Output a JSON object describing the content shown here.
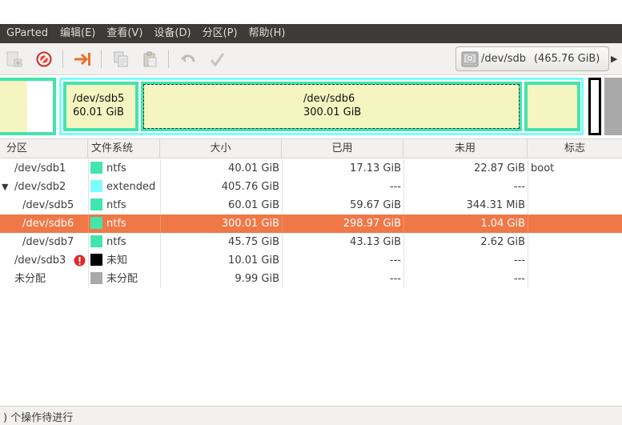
{
  "menubar": {
    "app_name": "GParted",
    "items": [
      "编辑(E)",
      "查看(V)",
      "设备(D)",
      "分区(P)",
      "帮助(H)"
    ]
  },
  "toolbar": {
    "buttons": [
      "new-partition-icon",
      "delete-icon",
      "resize-move-icon",
      "copy-icon",
      "paste-icon",
      "undo-icon",
      "apply-icon"
    ]
  },
  "device": {
    "name": "/dev/sdb",
    "size": "(465.76 GiB)"
  },
  "diskmap": {
    "partitions": [
      {
        "name": "/dev/sdb5",
        "size": "60.01 GiB"
      },
      {
        "name": "/dev/sdb6",
        "size": "300.01 GiB"
      }
    ]
  },
  "table": {
    "columns": [
      "分区",
      "文件系统",
      "大小",
      "已用",
      "未用",
      "标志"
    ],
    "rows": [
      {
        "partition": "/dev/sdb1",
        "fs": "ntfs",
        "fs_color": "#42e5ac",
        "size": "40.01 GiB",
        "used": "17.13 GiB",
        "unused": "22.87 GiB",
        "flags": "boot"
      },
      {
        "partition": "/dev/sdb2",
        "fs": "extended",
        "fs_color": "#7dfcfe",
        "size": "405.76 GiB",
        "used": "---",
        "unused": "---",
        "flags": ""
      },
      {
        "partition": "/dev/sdb5",
        "fs": "ntfs",
        "fs_color": "#42e5ac",
        "size": "60.01 GiB",
        "used": "59.67 GiB",
        "unused": "344.31 MiB",
        "flags": ""
      },
      {
        "partition": "/dev/sdb6",
        "fs": "ntfs",
        "fs_color": "#42e5ac",
        "size": "300.01 GiB",
        "used": "298.97 GiB",
        "unused": "1.04 GiB",
        "flags": ""
      },
      {
        "partition": "/dev/sdb7",
        "fs": "ntfs",
        "fs_color": "#42e5ac",
        "size": "45.75 GiB",
        "used": "43.13 GiB",
        "unused": "2.62 GiB",
        "flags": ""
      },
      {
        "partition": "/dev/sdb3",
        "fs": "未知",
        "fs_color": "#000000",
        "size": "10.01 GiB",
        "used": "---",
        "unused": "---",
        "flags": ""
      },
      {
        "partition": "未分配",
        "fs": "未分配",
        "fs_color": "#a9a9a9",
        "size": "9.99 GiB",
        "used": "---",
        "unused": "---",
        "flags": ""
      }
    ]
  },
  "status": {
    "text": ") 个操作待进行"
  },
  "colors": {
    "menubar_bg": "#3c3b37",
    "selection": "#f07746",
    "partition_fill": "#f5f5c2",
    "ntfs_border": "#42e5ac",
    "extended_border": "#7dfcfe"
  }
}
